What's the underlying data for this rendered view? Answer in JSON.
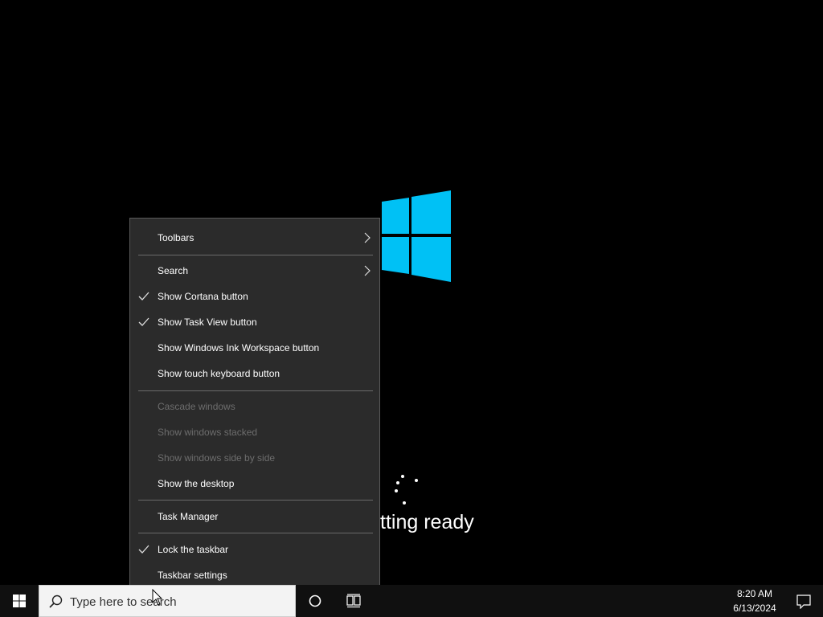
{
  "boot": {
    "status_text": "tting ready",
    "logo_color": "#00c1f5",
    "icon": "windows-logo"
  },
  "context_menu": {
    "items": [
      {
        "label": "Toolbars",
        "checked": false,
        "disabled": false,
        "submenu": true
      },
      {
        "label": "Search",
        "checked": false,
        "disabled": false,
        "submenu": true
      },
      {
        "label": "Show Cortana button",
        "checked": true,
        "disabled": false,
        "submenu": false
      },
      {
        "label": "Show Task View button",
        "checked": true,
        "disabled": false,
        "submenu": false
      },
      {
        "label": "Show Windows Ink Workspace button",
        "checked": false,
        "disabled": false,
        "submenu": false
      },
      {
        "label": "Show touch keyboard button",
        "checked": false,
        "disabled": false,
        "submenu": false
      },
      {
        "label": "Cascade windows",
        "checked": false,
        "disabled": true,
        "submenu": false
      },
      {
        "label": "Show windows stacked",
        "checked": false,
        "disabled": true,
        "submenu": false
      },
      {
        "label": "Show windows side by side",
        "checked": false,
        "disabled": true,
        "submenu": false
      },
      {
        "label": "Show the desktop",
        "checked": false,
        "disabled": false,
        "submenu": false
      },
      {
        "label": "Task Manager",
        "checked": false,
        "disabled": false,
        "submenu": false
      },
      {
        "label": "Lock the taskbar",
        "checked": true,
        "disabled": false,
        "submenu": false
      },
      {
        "label": "Taskbar settings",
        "checked": false,
        "disabled": false,
        "submenu": false
      }
    ]
  },
  "taskbar": {
    "search_placeholder": "Type here to search",
    "clock": {
      "time": "8:20 AM",
      "date": "6/13/2024"
    },
    "icons": [
      "windows-start-icon",
      "search-icon",
      "cortana-icon",
      "task-view-icon",
      "action-center-icon"
    ]
  },
  "colors": {
    "menu_bg": "#2b2b2b",
    "menu_disabled_text": "#6d6d6d",
    "taskbar_bg": "#101010"
  }
}
